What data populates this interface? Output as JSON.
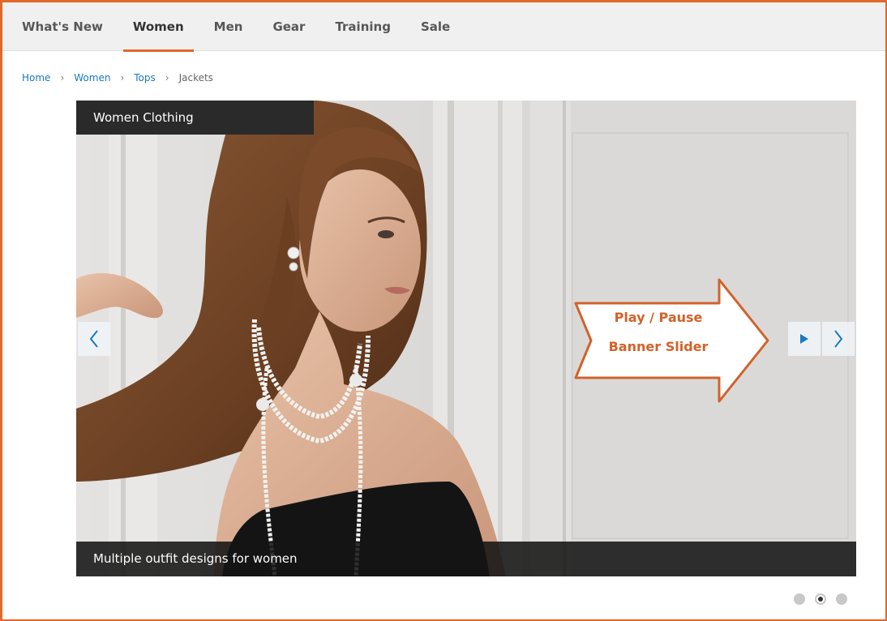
{
  "nav": {
    "items": [
      {
        "label": "What's New",
        "active": false
      },
      {
        "label": "Women",
        "active": true
      },
      {
        "label": "Men",
        "active": false
      },
      {
        "label": "Gear",
        "active": false
      },
      {
        "label": "Training",
        "active": false
      },
      {
        "label": "Sale",
        "active": false
      }
    ]
  },
  "breadcrumb": {
    "items": [
      "Home",
      "Women",
      "Tops"
    ],
    "current": "Jackets",
    "separator": "›"
  },
  "slider": {
    "title": "Women Clothing",
    "caption": "Multiple outfit designs for women",
    "prev_icon": "chevron-left-icon",
    "play_icon": "play-icon",
    "next_icon": "chevron-right-icon",
    "dots_total": 3,
    "dots_active": 2
  },
  "annotation": {
    "line1": "Play / Pause",
    "line2": "Banner Slider"
  },
  "colors": {
    "accent": "#e0692a",
    "link": "#1979c3",
    "control_arrow": "#1979c3"
  }
}
